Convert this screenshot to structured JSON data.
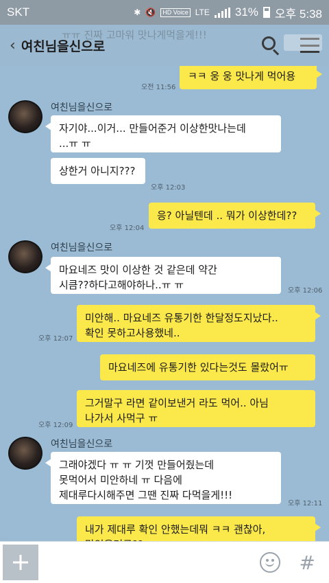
{
  "status": {
    "carrier": "SKT",
    "hd_label": "HD Voice",
    "lte_label": "LTE",
    "battery": "31%",
    "time": "오후 5:38",
    "icons": [
      "bluetooth-icon",
      "mute-icon",
      "signal-icon",
      "battery-icon"
    ]
  },
  "header": {
    "ghost_text": "ㅠㅠ 진짜 고마워 맛나게먹을게!!!",
    "title": "여친님을신으로",
    "back_icon": "‹",
    "search_icon": "search-icon",
    "menu_icon": "menu-icon"
  },
  "messages": [
    {
      "from": "me",
      "text": "ㅋㅋ 웅 웅 맛나게 먹어용",
      "time": "오전 11:56"
    },
    {
      "from": "them",
      "sender": "여친님을신으로",
      "text": "자기야...이거... 만들어준거 이상한맛나는데\n...ㅠ  ㅠ"
    },
    {
      "from": "them",
      "text": "상한거 아니지???",
      "time": "오후 12:03"
    },
    {
      "from": "me",
      "text": "응? 아닐텐데 .. 뭐가 이상한데??",
      "time": "오후 12:04"
    },
    {
      "from": "them",
      "sender": "여친님을신으로",
      "text": "마요네즈 맛이 이상한 것 같은데 약간\n시큼??하다고해야하나..ㅠ ㅠ",
      "time": "오후 12:06"
    },
    {
      "from": "me",
      "text": "미안해.. 마요네즈 유통기한 한달정도지났다..\n확인 못하고사용했네..",
      "time": "오후 12:07"
    },
    {
      "from": "me",
      "text": "마요네즈에 유통기한 있다는것도 몰랐어ㅠ"
    },
    {
      "from": "me",
      "text": "그거말구 라면 같이보낸거 라도 먹어.. 아님\n나가서 사먹구 ㅠ",
      "time": "오후 12:09"
    },
    {
      "from": "them",
      "sender": "여친님을신으로",
      "text": "그래야겠다 ㅠ ㅠ 기껏 만들어줬는데\n못먹어서 미안하네 ㅠ 다음에\n제대루다시해주면 그땐 진짜 다먹을게!!!",
      "time": "오후 12:11"
    },
    {
      "from": "me",
      "text": "내가 제대루 확인 안했는데뭐 ㅋㅋ 괜찮아,\n맛있을거구??"
    }
  ],
  "input": {
    "placeholder": "",
    "plus_icon": "plus-icon",
    "emoji_icon": "emoji-icon",
    "hash_label": "#"
  }
}
